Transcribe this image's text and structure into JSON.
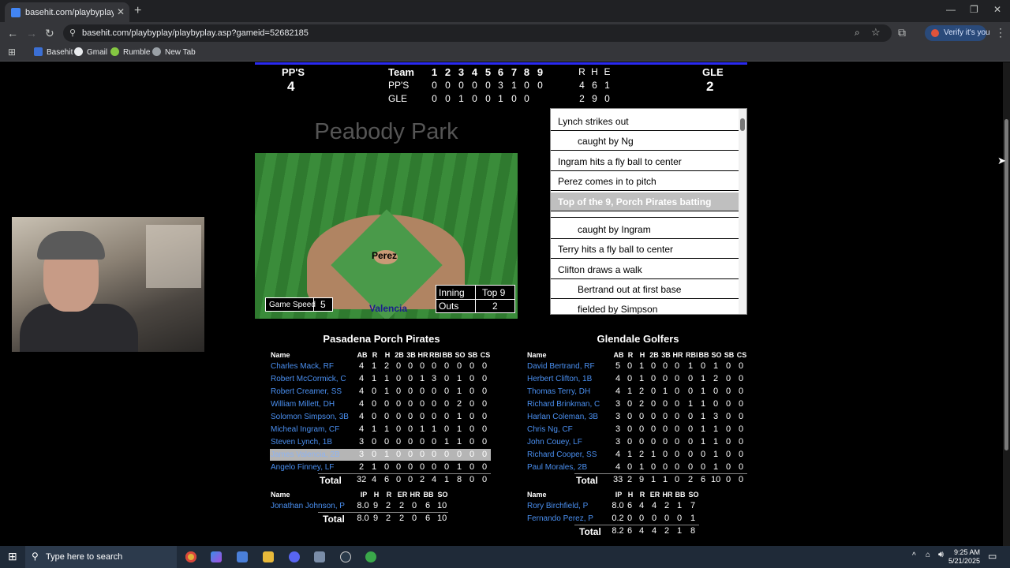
{
  "browser": {
    "tab_title": "basehit.com/playbyplay/playbyp",
    "url": "basehit.com/playbyplay/playbyplay.asp?gameid=52682185",
    "verify_label": "Verify it's you",
    "bookmarks": [
      "Basehit",
      "Gmail",
      "Rumble",
      "New Tab"
    ]
  },
  "scoreboard": {
    "away_abbr": "PP'S",
    "away_score": "4",
    "home_abbr": "GLE",
    "home_score": "2",
    "team_header": "Team",
    "innings": [
      "1",
      "2",
      "3",
      "4",
      "5",
      "6",
      "7",
      "8",
      "9"
    ],
    "rhe": [
      "R",
      "H",
      "E"
    ],
    "away_line": [
      "0",
      "0",
      "0",
      "0",
      "0",
      "3",
      "1",
      "0",
      "0"
    ],
    "away_rhe": [
      "4",
      "6",
      "1"
    ],
    "home_line": [
      "0",
      "0",
      "1",
      "0",
      "0",
      "1",
      "0",
      "0",
      ""
    ],
    "home_rhe": [
      "2",
      "9",
      "0"
    ]
  },
  "field": {
    "park": "Peabody Park",
    "pitcher": "Perez",
    "batter": "Valencia",
    "game_speed_label": "Game Speed",
    "game_speed": "5",
    "inning_label": "Inning",
    "inning": "Top 9",
    "outs_label": "Outs",
    "outs": "2"
  },
  "pbp": [
    {
      "text": "Lynch strikes out",
      "indent": false,
      "hl": false
    },
    {
      "text": "caught by Ng",
      "indent": true,
      "hl": false
    },
    {
      "text": "Ingram hits a fly ball to center",
      "indent": false,
      "hl": false
    },
    {
      "text": "Perez comes in to pitch",
      "indent": false,
      "hl": false
    },
    {
      "text": "Top of the 9, Porch Pirates batting",
      "indent": false,
      "hl": true
    },
    {
      "text": "caught by Ingram",
      "indent": true,
      "hl": false
    },
    {
      "text": "Terry hits a fly ball to center",
      "indent": false,
      "hl": false
    },
    {
      "text": "Clifton draws a walk",
      "indent": false,
      "hl": false
    },
    {
      "text": "Bertrand out at first base",
      "indent": true,
      "hl": false
    },
    {
      "text": "fielded by Simpson",
      "indent": true,
      "hl": false
    }
  ],
  "away_box": {
    "team": "Pasadena Porch Pirates",
    "headers": [
      "Name",
      "AB",
      "R",
      "H",
      "2B",
      "3B",
      "HR",
      "RBI",
      "BB",
      "SO",
      "SB",
      "CS"
    ],
    "rows": [
      {
        "name": "Charles Mack, RF",
        "stats": [
          "4",
          "1",
          "2",
          "0",
          "0",
          "0",
          "0",
          "0",
          "0",
          "0",
          "0"
        ]
      },
      {
        "name": "Robert McCormick, C",
        "stats": [
          "4",
          "1",
          "1",
          "0",
          "0",
          "1",
          "3",
          "0",
          "1",
          "0",
          "0"
        ]
      },
      {
        "name": "Robert Creamer, SS",
        "stats": [
          "4",
          "0",
          "1",
          "0",
          "0",
          "0",
          "0",
          "0",
          "1",
          "0",
          "0"
        ]
      },
      {
        "name": "William Millett, DH",
        "stats": [
          "4",
          "0",
          "0",
          "0",
          "0",
          "0",
          "0",
          "0",
          "2",
          "0",
          "0"
        ]
      },
      {
        "name": "Solomon Simpson, 3B",
        "stats": [
          "4",
          "0",
          "0",
          "0",
          "0",
          "0",
          "0",
          "0",
          "1",
          "0",
          "0"
        ]
      },
      {
        "name": "Micheal Ingram, CF",
        "stats": [
          "4",
          "1",
          "1",
          "0",
          "0",
          "1",
          "1",
          "0",
          "1",
          "0",
          "0"
        ]
      },
      {
        "name": "Steven Lynch, 1B",
        "stats": [
          "3",
          "0",
          "0",
          "0",
          "0",
          "0",
          "0",
          "1",
          "1",
          "0",
          "0"
        ]
      },
      {
        "name": "James Valencia, 2B",
        "stats": [
          "3",
          "0",
          "1",
          "0",
          "0",
          "0",
          "0",
          "0",
          "0",
          "0",
          "0"
        ],
        "hl": true
      },
      {
        "name": "Angelo Finney, LF",
        "stats": [
          "2",
          "1",
          "0",
          "0",
          "0",
          "0",
          "0",
          "0",
          "1",
          "0",
          "0"
        ]
      }
    ],
    "total_label": "Total",
    "totals": [
      "32",
      "4",
      "6",
      "0",
      "0",
      "2",
      "4",
      "1",
      "8",
      "0",
      "0"
    ],
    "pitch_headers": [
      "Name",
      "IP",
      "H",
      "R",
      "ER",
      "HR",
      "BB",
      "SO"
    ],
    "pitchers": [
      {
        "name": "Jonathan Johnson, P",
        "stats": [
          "8.0",
          "9",
          "2",
          "2",
          "0",
          "6",
          "10"
        ]
      }
    ],
    "pitch_totals": [
      "8.0",
      "9",
      "2",
      "2",
      "0",
      "6",
      "10"
    ]
  },
  "home_box": {
    "team": "Glendale Golfers",
    "headers": [
      "Name",
      "AB",
      "R",
      "H",
      "2B",
      "3B",
      "HR",
      "RBI",
      "BB",
      "SO",
      "SB",
      "CS"
    ],
    "rows": [
      {
        "name": "David Bertrand, RF",
        "stats": [
          "5",
          "0",
          "1",
          "0",
          "0",
          "0",
          "1",
          "0",
          "1",
          "0",
          "0"
        ]
      },
      {
        "name": "Herbert Clifton, 1B",
        "stats": [
          "4",
          "0",
          "1",
          "0",
          "0",
          "0",
          "0",
          "1",
          "2",
          "0",
          "0"
        ]
      },
      {
        "name": "Thomas Terry, DH",
        "stats": [
          "4",
          "1",
          "2",
          "0",
          "1",
          "0",
          "0",
          "1",
          "0",
          "0",
          "0"
        ]
      },
      {
        "name": "Richard Brinkman, C",
        "stats": [
          "3",
          "0",
          "2",
          "0",
          "0",
          "0",
          "1",
          "1",
          "0",
          "0",
          "0"
        ]
      },
      {
        "name": "Harlan Coleman, 3B",
        "stats": [
          "3",
          "0",
          "0",
          "0",
          "0",
          "0",
          "0",
          "1",
          "3",
          "0",
          "0"
        ]
      },
      {
        "name": "Chris Ng, CF",
        "stats": [
          "3",
          "0",
          "0",
          "0",
          "0",
          "0",
          "0",
          "1",
          "1",
          "0",
          "0"
        ]
      },
      {
        "name": "John Couey, LF",
        "stats": [
          "3",
          "0",
          "0",
          "0",
          "0",
          "0",
          "0",
          "1",
          "1",
          "0",
          "0"
        ]
      },
      {
        "name": "Richard Cooper, SS",
        "stats": [
          "4",
          "1",
          "2",
          "1",
          "0",
          "0",
          "0",
          "0",
          "1",
          "0",
          "0"
        ]
      },
      {
        "name": "Paul Morales, 2B",
        "stats": [
          "4",
          "0",
          "1",
          "0",
          "0",
          "0",
          "0",
          "0",
          "1",
          "0",
          "0"
        ]
      }
    ],
    "total_label": "Total",
    "totals": [
      "33",
      "2",
      "9",
      "1",
      "1",
      "0",
      "2",
      "6",
      "10",
      "0",
      "0"
    ],
    "pitch_headers": [
      "Name",
      "IP",
      "H",
      "R",
      "ER",
      "HR",
      "BB",
      "SO"
    ],
    "pitchers": [
      {
        "name": "Rory Birchfield, P",
        "stats": [
          "8.0",
          "6",
          "4",
          "4",
          "2",
          "1",
          "7"
        ]
      },
      {
        "name": "Fernando Perez, P",
        "stats": [
          "0.2",
          "0",
          "0",
          "0",
          "0",
          "0",
          "1"
        ]
      }
    ],
    "pitch_totals": [
      "8.2",
      "6",
      "4",
      "4",
      "2",
      "1",
      "8"
    ]
  },
  "taskbar": {
    "search_placeholder": "Type here to search",
    "time": "9:25 AM",
    "date": "5/21/2025"
  }
}
